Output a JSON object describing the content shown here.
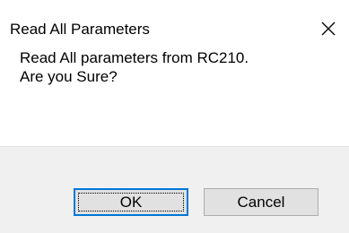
{
  "window": {
    "title": "Read All Parameters",
    "close_icon": "close-icon"
  },
  "message": {
    "line1": "Read All parameters from RC210.",
    "line2": "Are you Sure?"
  },
  "buttons": {
    "ok_label": "OK",
    "cancel_label": "Cancel"
  },
  "colors": {
    "default_button_border": "#0078d7",
    "button_face": "#e1e1e1",
    "button_bar": "#f0f0f0"
  }
}
